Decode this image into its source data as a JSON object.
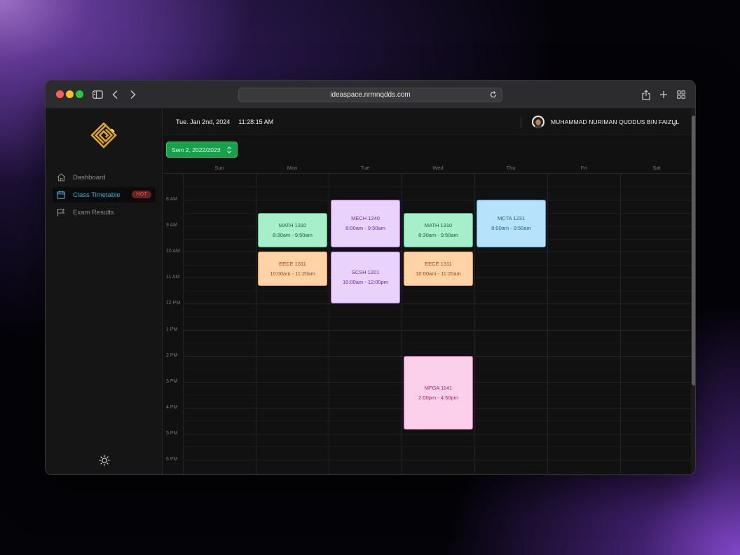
{
  "browser": {
    "url": "ideaspace.nrmnqdds.com",
    "lights": {
      "close": "#fe5f57",
      "minimize": "#febc2e",
      "zoom": "#28c840"
    }
  },
  "sidebar": {
    "items": [
      {
        "label": "Dashboard",
        "icon": "home-icon",
        "active": false
      },
      {
        "label": "Class Timetable",
        "icon": "calendar-icon",
        "active": true,
        "badge": "HOT"
      },
      {
        "label": "Exam Results",
        "icon": "flag-icon",
        "active": false
      }
    ],
    "accent": "#2bb5d8"
  },
  "header": {
    "date": "Tue. Jan 2nd, 2024",
    "time": "11:28:15 AM",
    "user_name": "MUHAMMAD NURIMAN QUDDUS BIN FAIZUL"
  },
  "semester": {
    "selected": "Sem 2, 2022/2023",
    "color": "#17a14a"
  },
  "calendar": {
    "days": [
      "Sun",
      "Mon",
      "Tue",
      "Wed",
      "Thu",
      "Fri",
      "Sat"
    ],
    "hours": [
      "8 AM",
      "9 AM",
      "10 AM",
      "11 AM",
      "12 PM",
      "1 PM",
      "2 PM",
      "3 PM",
      "4 PM",
      "5 PM",
      "6 PM"
    ],
    "events": [
      {
        "code": "MATH 1310",
        "time": "8:30am - 9:50am",
        "day": "Mon",
        "start": 8.5,
        "end": 9.833,
        "color": "green"
      },
      {
        "code": "EECE 1311",
        "time": "10:00am - 11:20am",
        "day": "Mon",
        "start": 10.0,
        "end": 11.333,
        "color": "orange"
      },
      {
        "code": "MECH 1240",
        "time": "8:00am - 9:50am",
        "day": "Tue",
        "start": 8.0,
        "end": 9.833,
        "color": "purple"
      },
      {
        "code": "SCSH 1201",
        "time": "10:00am - 12:00pm",
        "day": "Tue",
        "start": 10.0,
        "end": 12.0,
        "color": "purple"
      },
      {
        "code": "MATH 1310",
        "time": "8:30am - 9:50am",
        "day": "Wed",
        "start": 8.5,
        "end": 9.833,
        "color": "green"
      },
      {
        "code": "EECE 1311",
        "time": "10:00am - 11:20am",
        "day": "Wed",
        "start": 10.0,
        "end": 11.333,
        "color": "orange"
      },
      {
        "code": "MFGA 1141",
        "time": "2:00pm - 4:50pm",
        "day": "Wed",
        "start": 14.0,
        "end": 16.833,
        "color": "pink"
      },
      {
        "code": "MCTA 1231",
        "time": "8:00am - 9:50am",
        "day": "Thu",
        "start": 8.0,
        "end": 9.833,
        "color": "blue"
      }
    ]
  }
}
